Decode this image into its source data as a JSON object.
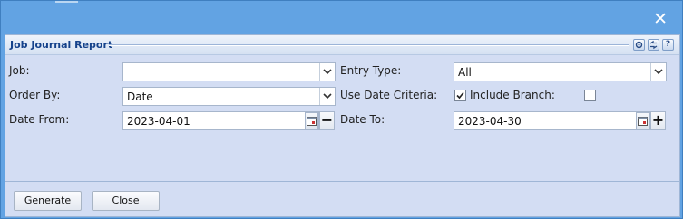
{
  "dialog": {
    "title": "Job Journal Report"
  },
  "window": {
    "close_glyph": "✕",
    "help_glyph": "?"
  },
  "form": {
    "job_label": "Job:",
    "job_value": "",
    "entry_type_label": "Entry Type:",
    "entry_type_value": "All",
    "order_by_label": "Order By:",
    "order_by_value": "Date",
    "use_date_criteria_label": "Use Date Criteria:",
    "use_date_criteria_checked": true,
    "include_branch_label": "Include Branch:",
    "include_branch_checked": false,
    "date_from_label": "Date From:",
    "date_from_value": "2023-04-01",
    "date_to_label": "Date To:",
    "date_to_value": "2023-04-30",
    "minus_glyph": "−",
    "plus_glyph": "+"
  },
  "footer": {
    "generate_label": "Generate",
    "close_label": "Close"
  },
  "icons": [
    "close-icon",
    "gear-icon",
    "refresh-icon",
    "help-icon",
    "chevron-down-icon",
    "calendar-icon",
    "checkmark-icon"
  ],
  "colors": {
    "window_bg": "#62a3e3",
    "panel_bg": "#d3ddf3",
    "title_text": "#15428b"
  }
}
